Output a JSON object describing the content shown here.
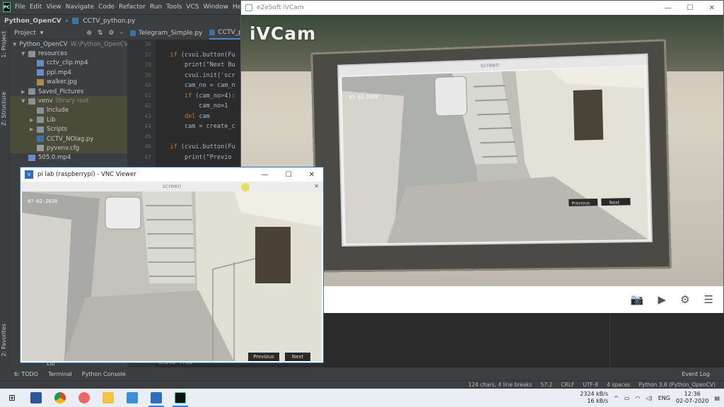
{
  "ide": {
    "menu": [
      "File",
      "Edit",
      "View",
      "Navigate",
      "Code",
      "Refactor",
      "Run",
      "Tools",
      "VCS",
      "Window",
      "Help"
    ],
    "project_name": "Python_OpenCV",
    "current_file": "CCTV_python.py",
    "project_panel_label": "Project",
    "side_tabs": {
      "project": "1: Project",
      "structure": "Z: Structure",
      "favorites": "2: Favorites"
    },
    "tree": [
      {
        "label": "Python_OpenCV",
        "extra": "W:\\Python_OpenCV",
        "level": 0,
        "type": "folder",
        "arrow": "▼"
      },
      {
        "label": "resources",
        "level": 1,
        "type": "folder",
        "arrow": "▼"
      },
      {
        "label": "cctv_clip.mp4",
        "level": 2,
        "type": "mp4"
      },
      {
        "label": "ppl.mp4",
        "level": 2,
        "type": "mp4"
      },
      {
        "label": "walker.jpg",
        "level": 2,
        "type": "jpg"
      },
      {
        "label": "Saved_Pictures",
        "level": 1,
        "type": "folder",
        "arrow": "▶"
      },
      {
        "label": "venv",
        "extra": "library root",
        "level": 1,
        "type": "folder",
        "arrow": "▼",
        "hl": true
      },
      {
        "label": "Include",
        "level": 2,
        "type": "folder",
        "hl": true
      },
      {
        "label": "Lib",
        "level": 2,
        "type": "folder",
        "arrow": "▶",
        "hl": true
      },
      {
        "label": "Scripts",
        "level": 2,
        "type": "folder",
        "arrow": "▶",
        "hl": true
      },
      {
        "label": "CCTV_NOlag.py",
        "level": 2,
        "type": "py",
        "hl": true
      },
      {
        "label": "pyvenv.cfg",
        "level": 2,
        "type": "cfg",
        "hl": true
      },
      {
        "label": "505.0.mp4",
        "level": 1,
        "type": "mp4"
      }
    ],
    "tree_lib_tail": "Lib",
    "tabs": [
      "Telegram_Simple.py",
      "CCTV_pyt"
    ],
    "line_numbers": [
      "36",
      "37",
      "38",
      "39",
      "40",
      "41",
      "42",
      "43",
      "44",
      "45",
      "46",
      "47"
    ],
    "code_lines": [
      {
        "pre": "",
        "kw": "",
        "rest": ""
      },
      {
        "pre": "    ",
        "kw": "if ",
        "rest": "(cvui.button(Fu"
      },
      {
        "pre": "        ",
        "kw": "",
        "rest": "print(\"Next Bu"
      },
      {
        "pre": "        ",
        "kw": "",
        "rest": "cvui.init('scr"
      },
      {
        "pre": "        ",
        "kw": "",
        "rest": "cam_no = cam_n"
      },
      {
        "pre": "        ",
        "kw": "if ",
        "rest": "(cam_no>4):"
      },
      {
        "pre": "            ",
        "kw": "",
        "rest": "cam_no=1"
      },
      {
        "pre": "        ",
        "kw": "del ",
        "rest": "cam"
      },
      {
        "pre": "        ",
        "kw": "",
        "rest": "cam = create_c"
      },
      {
        "pre": "",
        "kw": "",
        "rest": ""
      },
      {
        "pre": "    ",
        "kw": "if ",
        "rest": "(cvui.button(Fu"
      },
      {
        "pre": "        ",
        "kw": "",
        "rest": "print(\"Previo"
      }
    ],
    "below_code": "while True",
    "tool_tabs": [
      "6: TODO",
      "Terminal",
      "Python Console"
    ],
    "event_log": "Event Log",
    "status": [
      "124 chars, 4 line breaks",
      "57:2",
      "CRLF",
      "UTF-8",
      "4 spaces",
      "Python 3.8 (Python_OpenCV)"
    ]
  },
  "ivcam": {
    "title": "e2eSoft iVCam",
    "logo": "iVCam",
    "screen_label": "screen",
    "toolbar": {
      "camera": "camera-icon",
      "video": "video-icon",
      "settings": "gear-icon",
      "menu": "menu-icon"
    }
  },
  "vnc": {
    "title": "pi lab (raspberrypi) - VNC Viewer",
    "screen_label": "screen",
    "previous": "Previous",
    "next": "Next",
    "timestamp": "07-02-2020"
  },
  "taskbar": {
    "upload": "2324 kB/s",
    "download": "16 kB/s",
    "lang": "ENG",
    "time": "12:36",
    "date": "02-07-2020"
  },
  "colors": {
    "ide_bg": "#2b2b2b",
    "panel": "#3c3f41",
    "accent": "#4a88c7",
    "vnc_border": "#2f78c4"
  }
}
